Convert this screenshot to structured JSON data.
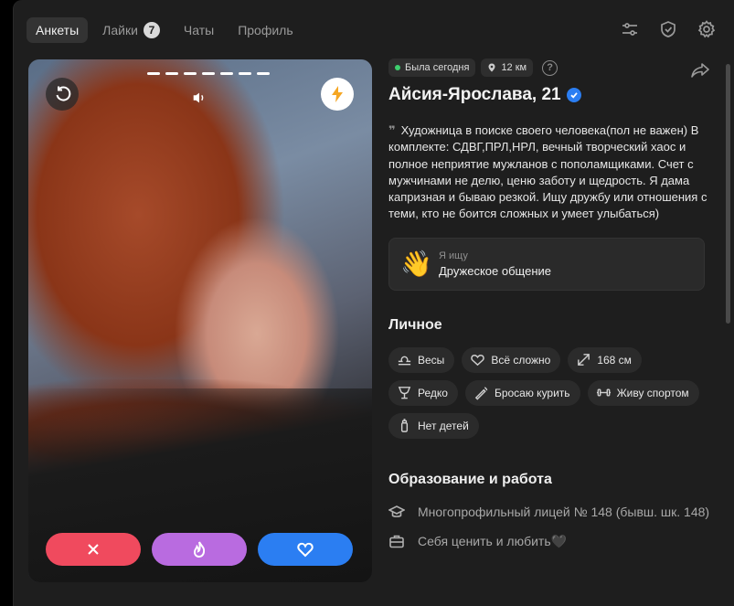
{
  "tabs": [
    {
      "label": "Анкеты",
      "active": true
    },
    {
      "label": "Лайки",
      "badge": "7"
    },
    {
      "label": "Чаты"
    },
    {
      "label": "Профиль"
    }
  ],
  "top_icons": [
    "filters-icon",
    "shield-icon",
    "gear-icon"
  ],
  "photo": {
    "story_count": 7,
    "icons": [
      "undo-icon",
      "sound-icon",
      "lightning-icon"
    ]
  },
  "actions": [
    "close-icon",
    "fire-icon",
    "heart-icon"
  ],
  "profile": {
    "status": "Была сегодня",
    "distance": "12 км",
    "help": "?",
    "name": "Айсия-Ярослава, 21",
    "quote_mark": "❞",
    "bio": "Художница в поиске своего человека(пол не важен) В комплекте: СДВГ,ПРЛ,НРЛ, вечный творческий хаос и полное неприятие мужланов с пополамщиками. Счет с мужчинами не делю, ценю заботу и щедрость. Я дама капризная и бываю резкой. Ищу дружбу или отношения с теми, кто не боится сложных и умеет улыбаться)",
    "looking": {
      "emoji": "👋",
      "label": "Я ищу",
      "value": "Дружеское общение"
    }
  },
  "personal": {
    "title": "Личное",
    "chips": [
      {
        "icon": "libra-icon",
        "label": "Весы"
      },
      {
        "icon": "heart-outline-icon",
        "label": "Всё сложно"
      },
      {
        "icon": "height-icon",
        "label": "168 см"
      },
      {
        "icon": "glass-icon",
        "label": "Редко"
      },
      {
        "icon": "cigarette-icon",
        "label": "Бросаю курить"
      },
      {
        "icon": "dumbbell-icon",
        "label": "Живу спортом"
      },
      {
        "icon": "bottle-icon",
        "label": "Нет детей"
      }
    ]
  },
  "education": {
    "title": "Образование и работа",
    "school": "Многопрофильный лицей № 148 (бывш. шк. 148)",
    "work": "Себя ценить и любить🖤"
  },
  "colors": {
    "dislike": "#f04a5e",
    "superlike": "#b96be0",
    "like": "#2b7ef2",
    "online": "#3ecf6e"
  }
}
